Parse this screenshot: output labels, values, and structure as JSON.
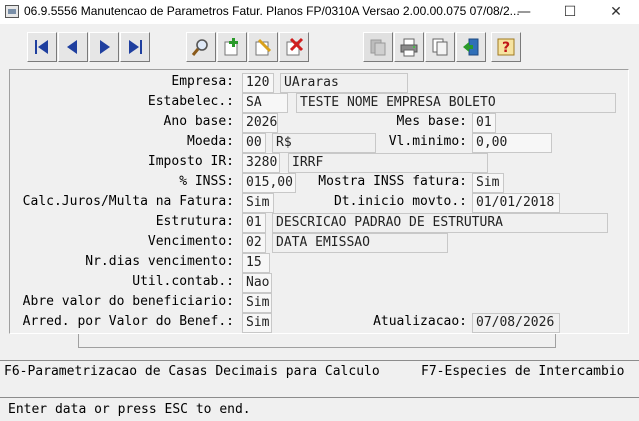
{
  "window": {
    "title": "06.9.5556 Manutencao  de Parametros Fatur. Planos FP/0310A Versao 2.00.00.075 07/08/2...",
    "controls": [
      "—",
      "☐",
      "✕"
    ]
  },
  "toolbar": {
    "buttons": [
      "first-record",
      "previous-record",
      "next-record",
      "last-record",
      "zoom",
      "add",
      "edit",
      "delete",
      "copy-disabled",
      "print",
      "copy",
      "exit",
      "help"
    ]
  },
  "form": {
    "empresa": {
      "label": "Empresa:",
      "code": "120",
      "desc": "UAraras"
    },
    "estabelec": {
      "label": "Estabelec.:",
      "code": "SA",
      "desc": "TESTE NOME EMPRESA BOLETO"
    },
    "ano_base": {
      "label": "Ano base:",
      "value": "2026"
    },
    "mes_base": {
      "label": "Mes base:",
      "value": "01"
    },
    "moeda": {
      "label": "Moeda:",
      "code": "00",
      "desc": "R$"
    },
    "vl_minimo": {
      "label": "Vl.minimo:",
      "value": "0,00"
    },
    "imposto_ir": {
      "label": "Imposto IR:",
      "code": "3280",
      "desc": "IRRF"
    },
    "inss": {
      "label": "% INSS:",
      "value": "015,00"
    },
    "mostra_inss": {
      "label": "Mostra INSS fatura:",
      "value": "Sim"
    },
    "calc_juros": {
      "label": "Calc.Juros/Multa na Fatura:",
      "value": "Sim"
    },
    "dt_inicio": {
      "label": "Dt.inicio movto.:",
      "value": "01/01/2018"
    },
    "estrutura": {
      "label": "Estrutura:",
      "code": "01",
      "desc": "DESCRICAO PADRAO DE ESTRUTURA"
    },
    "vencimento": {
      "label": "Vencimento:",
      "code": "02",
      "desc": "DATA EMISSAO"
    },
    "nr_dias": {
      "label": "Nr.dias vencimento:",
      "value": "15"
    },
    "util_contab": {
      "label": "Util.contab.:",
      "value": "Nao"
    },
    "abre_valor": {
      "label": "Abre valor do beneficiario:",
      "value": "Sim"
    },
    "arred": {
      "label": "Arred. por Valor do Benef.:",
      "value": "Sim"
    },
    "atualizacao": {
      "label": "Atualizacao:",
      "value": "07/08/2026"
    }
  },
  "status": {
    "f6": "F6-Parametrizacao de Casas Decimais para Calculo",
    "f7": "F7-Especies de Intercambio",
    "message": "Enter data or press ESC to end."
  }
}
